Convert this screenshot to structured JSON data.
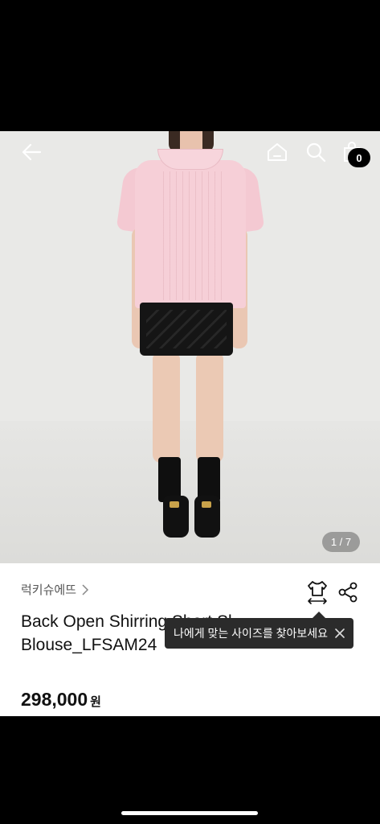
{
  "header": {
    "back_icon": "arrow-left-icon",
    "home_icon": "home-icon",
    "search_icon": "search-icon",
    "cart_icon": "shopping-bag-icon",
    "cart_count": "0"
  },
  "gallery": {
    "counter": "1 / 7"
  },
  "product": {
    "brand": "럭키슈에뜨",
    "title_line1": "Back Open Shirring Short Sl",
    "title_line2": "Blouse_LFSAM24",
    "price": "298,000",
    "currency": "원",
    "size_icon": "shirt-size-icon",
    "share_icon": "share-icon"
  },
  "tooltip": {
    "text": "나에게 맞는 사이즈를 찾아보세요",
    "close_icon": "close-icon",
    "background": "#2b2b2b"
  },
  "colors": {
    "blouse": "#f6cfd7",
    "skirt": "#151515",
    "badge": "#000000"
  }
}
